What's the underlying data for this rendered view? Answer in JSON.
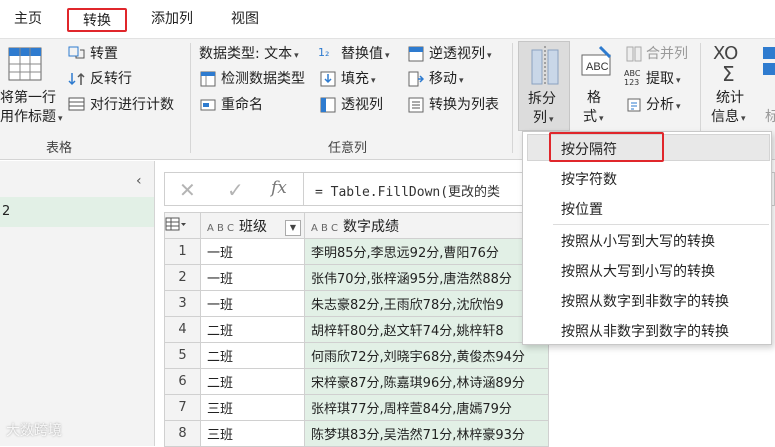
{
  "menu": {
    "tabs": [
      {
        "label": "主页"
      },
      {
        "label": "转换"
      },
      {
        "label": "添加列"
      },
      {
        "label": "视图"
      }
    ]
  },
  "ribbon": {
    "table_group": {
      "label": "表格",
      "first_row_header_line1": "将第一行",
      "first_row_header_line2": "用作标题",
      "transpose": "转置",
      "reverse_rows": "反转行",
      "count_rows": "对行进行计数"
    },
    "any_column_group": {
      "label": "任意列",
      "data_type": "数据类型: 文本",
      "detect_type": "检测数据类型",
      "rename": "重命名",
      "replace_values": "替换值",
      "fill": "填充",
      "pivot": "透视列",
      "unpivot": "逆透视列",
      "move": "移动",
      "to_list": "转换为列表"
    },
    "text_column": {
      "split_line1": "拆分",
      "split_line2": "列",
      "format_line1": "格",
      "format_line2": "式",
      "merge": "合并列",
      "extract": "提取",
      "parse": "分析",
      "abc_123": "ABC\n123"
    },
    "number_column": {
      "stats_line1": "统计",
      "stats_line2": "信息",
      "next_label": "标"
    }
  },
  "left_panel": {
    "item": "2"
  },
  "formula_bar": {
    "cancel": "✕",
    "confirm": "✓",
    "fx": "fx",
    "formula": "= Table.FillDown(更改的类"
  },
  "table": {
    "type_label": "A B C",
    "columns": [
      "班级",
      "数字成绩"
    ],
    "rows": [
      {
        "n": "1",
        "class": "一班",
        "scores": "李明85分,李思远92分,曹阳76分"
      },
      {
        "n": "2",
        "class": "一班",
        "scores": "张伟70分,张梓涵95分,唐浩然88分"
      },
      {
        "n": "3",
        "class": "一班",
        "scores": "朱志豪82分,王雨欣78分,沈欣怡9"
      },
      {
        "n": "4",
        "class": "二班",
        "scores": "胡梓轩80分,赵文轩74分,姚梓轩8"
      },
      {
        "n": "5",
        "class": "二班",
        "scores": "何雨欣72分,刘晓宇68分,黄俊杰94分"
      },
      {
        "n": "6",
        "class": "二班",
        "scores": "宋梓豪87分,陈嘉琪96分,林诗涵89分"
      },
      {
        "n": "7",
        "class": "三班",
        "scores": "张梓琪77分,周梓萱84分,唐嫣79分"
      },
      {
        "n": "8",
        "class": "三班",
        "scores": "陈梦琪83分,吴浩然71分,林梓豪93分"
      }
    ]
  },
  "dropdown": {
    "items": [
      "按分隔符",
      "按字符数",
      "按位置",
      "按照从小写到大写的转换",
      "按照从大写到小写的转换",
      "按照从数字到非数字的转换",
      "按照从非数字到数字的转换"
    ]
  },
  "watermark": "大数跨境",
  "colors": {
    "accent_red": "#e0262b",
    "selected_column": "#e2f0e6",
    "ribbon_bg": "#f3f3f3"
  }
}
